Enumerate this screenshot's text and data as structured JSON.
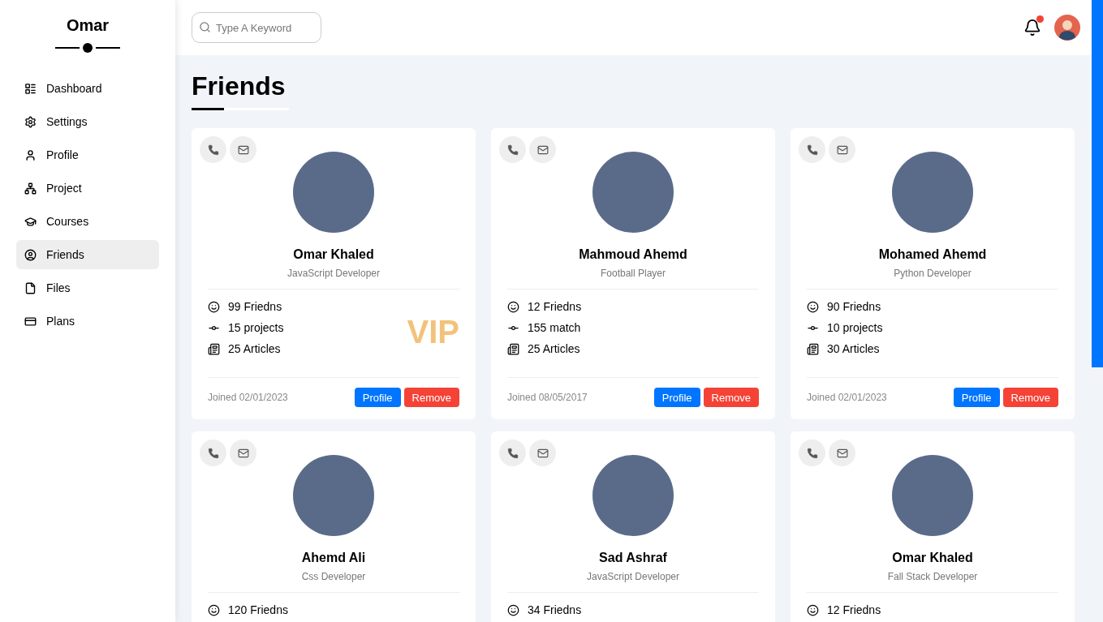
{
  "sidebar": {
    "title": "Omar",
    "items": [
      {
        "kind": "dashboard",
        "label": "Dashboard",
        "selected": false
      },
      {
        "kind": "settings",
        "label": "Settings",
        "selected": false
      },
      {
        "kind": "profile",
        "label": "Profile",
        "selected": false
      },
      {
        "kind": "project",
        "label": "Project",
        "selected": false
      },
      {
        "kind": "courses",
        "label": "Courses",
        "selected": false
      },
      {
        "kind": "friends",
        "label": "Friends",
        "selected": true
      },
      {
        "kind": "files",
        "label": "Files",
        "selected": false
      },
      {
        "kind": "plans",
        "label": "Plans",
        "selected": false
      }
    ]
  },
  "header": {
    "search": {
      "placeholder": "Type A Keyword"
    },
    "notifications": {
      "unread": true
    }
  },
  "page_title": "Friends",
  "friends": [
    {
      "name": "Omar Khaled",
      "role": "JavaScript Developer",
      "badge": "VIP",
      "stats": [
        {
          "kind": "friends",
          "text": "99 Friedns"
        },
        {
          "kind": "projects",
          "text": "15 projects"
        },
        {
          "kind": "articles",
          "text": "25 Articles"
        }
      ],
      "joined": "Joined 02/01/2023",
      "actions": [
        {
          "kind": "primary",
          "label": "Profile"
        },
        {
          "kind": "danger",
          "label": "Remove"
        }
      ]
    },
    {
      "name": "Mahmoud Ahemd",
      "role": "Football Player",
      "stats": [
        {
          "kind": "friends",
          "text": "12 Friedns"
        },
        {
          "kind": "projects",
          "text": "155 match"
        },
        {
          "kind": "articles",
          "text": "25 Articles"
        }
      ],
      "joined": "Joined 08/05/2017",
      "actions": [
        {
          "kind": "primary",
          "label": "Profile"
        },
        {
          "kind": "danger",
          "label": "Remove"
        }
      ]
    },
    {
      "name": "Mohamed Ahemd",
      "role": "Python Developer",
      "stats": [
        {
          "kind": "friends",
          "text": "90 Friedns"
        },
        {
          "kind": "projects",
          "text": "10 projects"
        },
        {
          "kind": "articles",
          "text": "30 Articles"
        }
      ],
      "joined": "Joined 02/01/2023",
      "actions": [
        {
          "kind": "primary",
          "label": "Profile"
        },
        {
          "kind": "danger",
          "label": "Remove"
        }
      ]
    },
    {
      "name": "Ahemd Ali",
      "role": "Css Developer",
      "stats": [
        {
          "kind": "friends",
          "text": "120 Friedns"
        }
      ]
    },
    {
      "name": "Sad Ashraf",
      "role": "JavaScript Developer",
      "stats": [
        {
          "kind": "friends",
          "text": "34 Friedns"
        }
      ]
    },
    {
      "name": "Omar Khaled",
      "role": "Fall Stack Developer",
      "stats": [
        {
          "kind": "friends",
          "text": "12 Friedns"
        }
      ]
    }
  ]
}
